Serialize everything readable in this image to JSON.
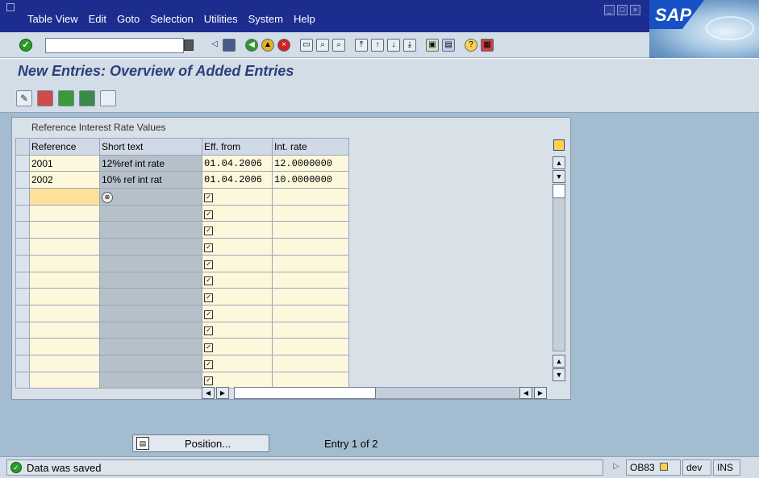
{
  "menubar": {
    "items": [
      "Table View",
      "Edit",
      "Goto",
      "Selection",
      "Utilities",
      "System",
      "Help"
    ]
  },
  "branding": {
    "logo": "SAP"
  },
  "toolbar": {
    "command_value": ""
  },
  "title": "New Entries: Overview of Added Entries",
  "table": {
    "caption": "Reference Interest Rate Values",
    "columns": [
      "Reference",
      "Short text",
      "Eff. from",
      "Int. rate"
    ],
    "rows": [
      {
        "reference": "2001",
        "short_text": "12%ref int rate",
        "eff_from": "01.04.2006",
        "int_rate": "12.0000000"
      },
      {
        "reference": "2002",
        "short_text": "10% ref int rat",
        "eff_from": "01.04.2006",
        "int_rate": "10.0000000"
      }
    ],
    "empty_rows": 12
  },
  "footer": {
    "position_label": "Position...",
    "entry_info": "Entry 1 of 2"
  },
  "status": {
    "message": "Data was saved",
    "transaction": "OB83",
    "system": "dev",
    "mode": "INS"
  },
  "colors": {
    "menubar": "#1c2d8f",
    "title": "#2b3f78",
    "background": "#a4bccf"
  }
}
